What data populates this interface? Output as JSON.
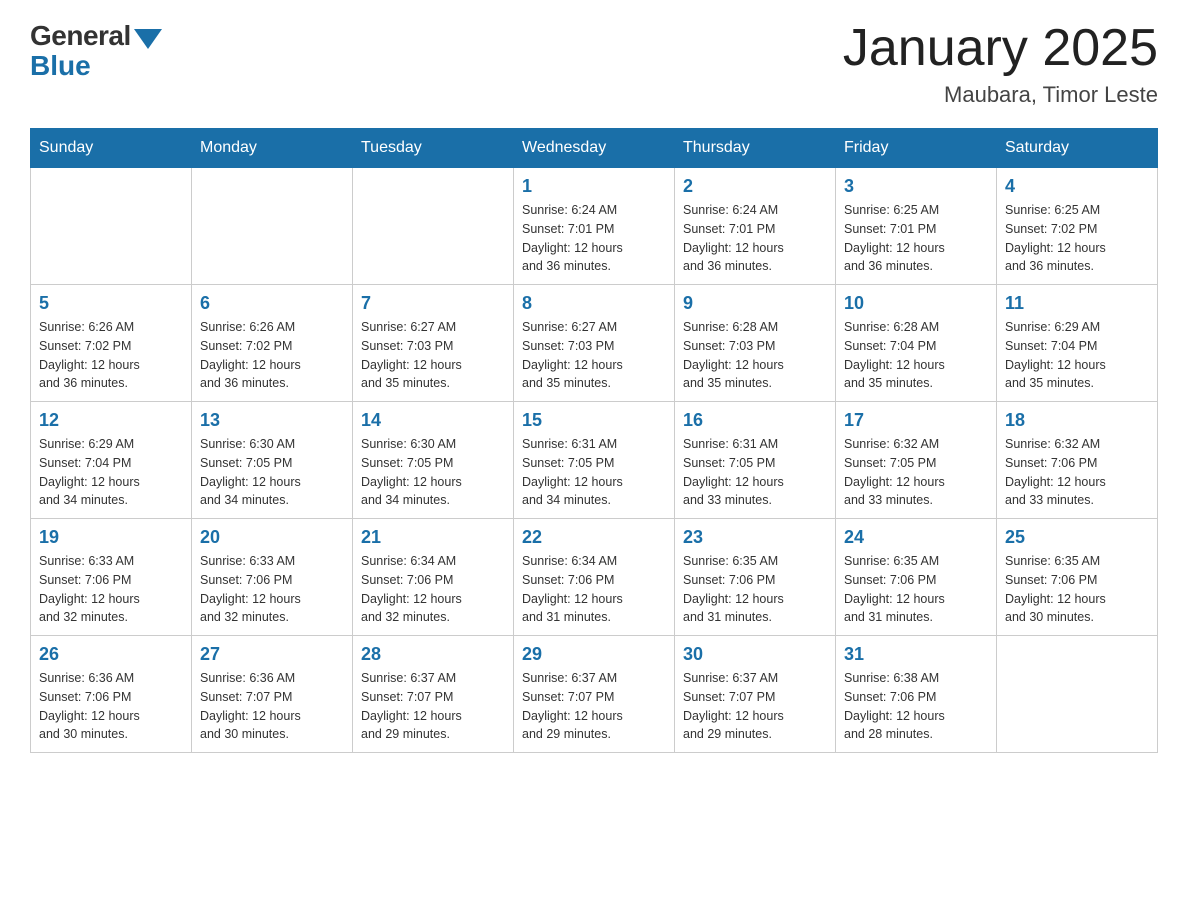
{
  "header": {
    "logo_general": "General",
    "logo_blue": "Blue",
    "month_title": "January 2025",
    "location": "Maubara, Timor Leste"
  },
  "weekdays": [
    "Sunday",
    "Monday",
    "Tuesday",
    "Wednesday",
    "Thursday",
    "Friday",
    "Saturday"
  ],
  "weeks": [
    [
      {
        "day": "",
        "info": ""
      },
      {
        "day": "",
        "info": ""
      },
      {
        "day": "",
        "info": ""
      },
      {
        "day": "1",
        "info": "Sunrise: 6:24 AM\nSunset: 7:01 PM\nDaylight: 12 hours\nand 36 minutes."
      },
      {
        "day": "2",
        "info": "Sunrise: 6:24 AM\nSunset: 7:01 PM\nDaylight: 12 hours\nand 36 minutes."
      },
      {
        "day": "3",
        "info": "Sunrise: 6:25 AM\nSunset: 7:01 PM\nDaylight: 12 hours\nand 36 minutes."
      },
      {
        "day": "4",
        "info": "Sunrise: 6:25 AM\nSunset: 7:02 PM\nDaylight: 12 hours\nand 36 minutes."
      }
    ],
    [
      {
        "day": "5",
        "info": "Sunrise: 6:26 AM\nSunset: 7:02 PM\nDaylight: 12 hours\nand 36 minutes."
      },
      {
        "day": "6",
        "info": "Sunrise: 6:26 AM\nSunset: 7:02 PM\nDaylight: 12 hours\nand 36 minutes."
      },
      {
        "day": "7",
        "info": "Sunrise: 6:27 AM\nSunset: 7:03 PM\nDaylight: 12 hours\nand 35 minutes."
      },
      {
        "day": "8",
        "info": "Sunrise: 6:27 AM\nSunset: 7:03 PM\nDaylight: 12 hours\nand 35 minutes."
      },
      {
        "day": "9",
        "info": "Sunrise: 6:28 AM\nSunset: 7:03 PM\nDaylight: 12 hours\nand 35 minutes."
      },
      {
        "day": "10",
        "info": "Sunrise: 6:28 AM\nSunset: 7:04 PM\nDaylight: 12 hours\nand 35 minutes."
      },
      {
        "day": "11",
        "info": "Sunrise: 6:29 AM\nSunset: 7:04 PM\nDaylight: 12 hours\nand 35 minutes."
      }
    ],
    [
      {
        "day": "12",
        "info": "Sunrise: 6:29 AM\nSunset: 7:04 PM\nDaylight: 12 hours\nand 34 minutes."
      },
      {
        "day": "13",
        "info": "Sunrise: 6:30 AM\nSunset: 7:05 PM\nDaylight: 12 hours\nand 34 minutes."
      },
      {
        "day": "14",
        "info": "Sunrise: 6:30 AM\nSunset: 7:05 PM\nDaylight: 12 hours\nand 34 minutes."
      },
      {
        "day": "15",
        "info": "Sunrise: 6:31 AM\nSunset: 7:05 PM\nDaylight: 12 hours\nand 34 minutes."
      },
      {
        "day": "16",
        "info": "Sunrise: 6:31 AM\nSunset: 7:05 PM\nDaylight: 12 hours\nand 33 minutes."
      },
      {
        "day": "17",
        "info": "Sunrise: 6:32 AM\nSunset: 7:05 PM\nDaylight: 12 hours\nand 33 minutes."
      },
      {
        "day": "18",
        "info": "Sunrise: 6:32 AM\nSunset: 7:06 PM\nDaylight: 12 hours\nand 33 minutes."
      }
    ],
    [
      {
        "day": "19",
        "info": "Sunrise: 6:33 AM\nSunset: 7:06 PM\nDaylight: 12 hours\nand 32 minutes."
      },
      {
        "day": "20",
        "info": "Sunrise: 6:33 AM\nSunset: 7:06 PM\nDaylight: 12 hours\nand 32 minutes."
      },
      {
        "day": "21",
        "info": "Sunrise: 6:34 AM\nSunset: 7:06 PM\nDaylight: 12 hours\nand 32 minutes."
      },
      {
        "day": "22",
        "info": "Sunrise: 6:34 AM\nSunset: 7:06 PM\nDaylight: 12 hours\nand 31 minutes."
      },
      {
        "day": "23",
        "info": "Sunrise: 6:35 AM\nSunset: 7:06 PM\nDaylight: 12 hours\nand 31 minutes."
      },
      {
        "day": "24",
        "info": "Sunrise: 6:35 AM\nSunset: 7:06 PM\nDaylight: 12 hours\nand 31 minutes."
      },
      {
        "day": "25",
        "info": "Sunrise: 6:35 AM\nSunset: 7:06 PM\nDaylight: 12 hours\nand 30 minutes."
      }
    ],
    [
      {
        "day": "26",
        "info": "Sunrise: 6:36 AM\nSunset: 7:06 PM\nDaylight: 12 hours\nand 30 minutes."
      },
      {
        "day": "27",
        "info": "Sunrise: 6:36 AM\nSunset: 7:07 PM\nDaylight: 12 hours\nand 30 minutes."
      },
      {
        "day": "28",
        "info": "Sunrise: 6:37 AM\nSunset: 7:07 PM\nDaylight: 12 hours\nand 29 minutes."
      },
      {
        "day": "29",
        "info": "Sunrise: 6:37 AM\nSunset: 7:07 PM\nDaylight: 12 hours\nand 29 minutes."
      },
      {
        "day": "30",
        "info": "Sunrise: 6:37 AM\nSunset: 7:07 PM\nDaylight: 12 hours\nand 29 minutes."
      },
      {
        "day": "31",
        "info": "Sunrise: 6:38 AM\nSunset: 7:06 PM\nDaylight: 12 hours\nand 28 minutes."
      },
      {
        "day": "",
        "info": ""
      }
    ]
  ]
}
